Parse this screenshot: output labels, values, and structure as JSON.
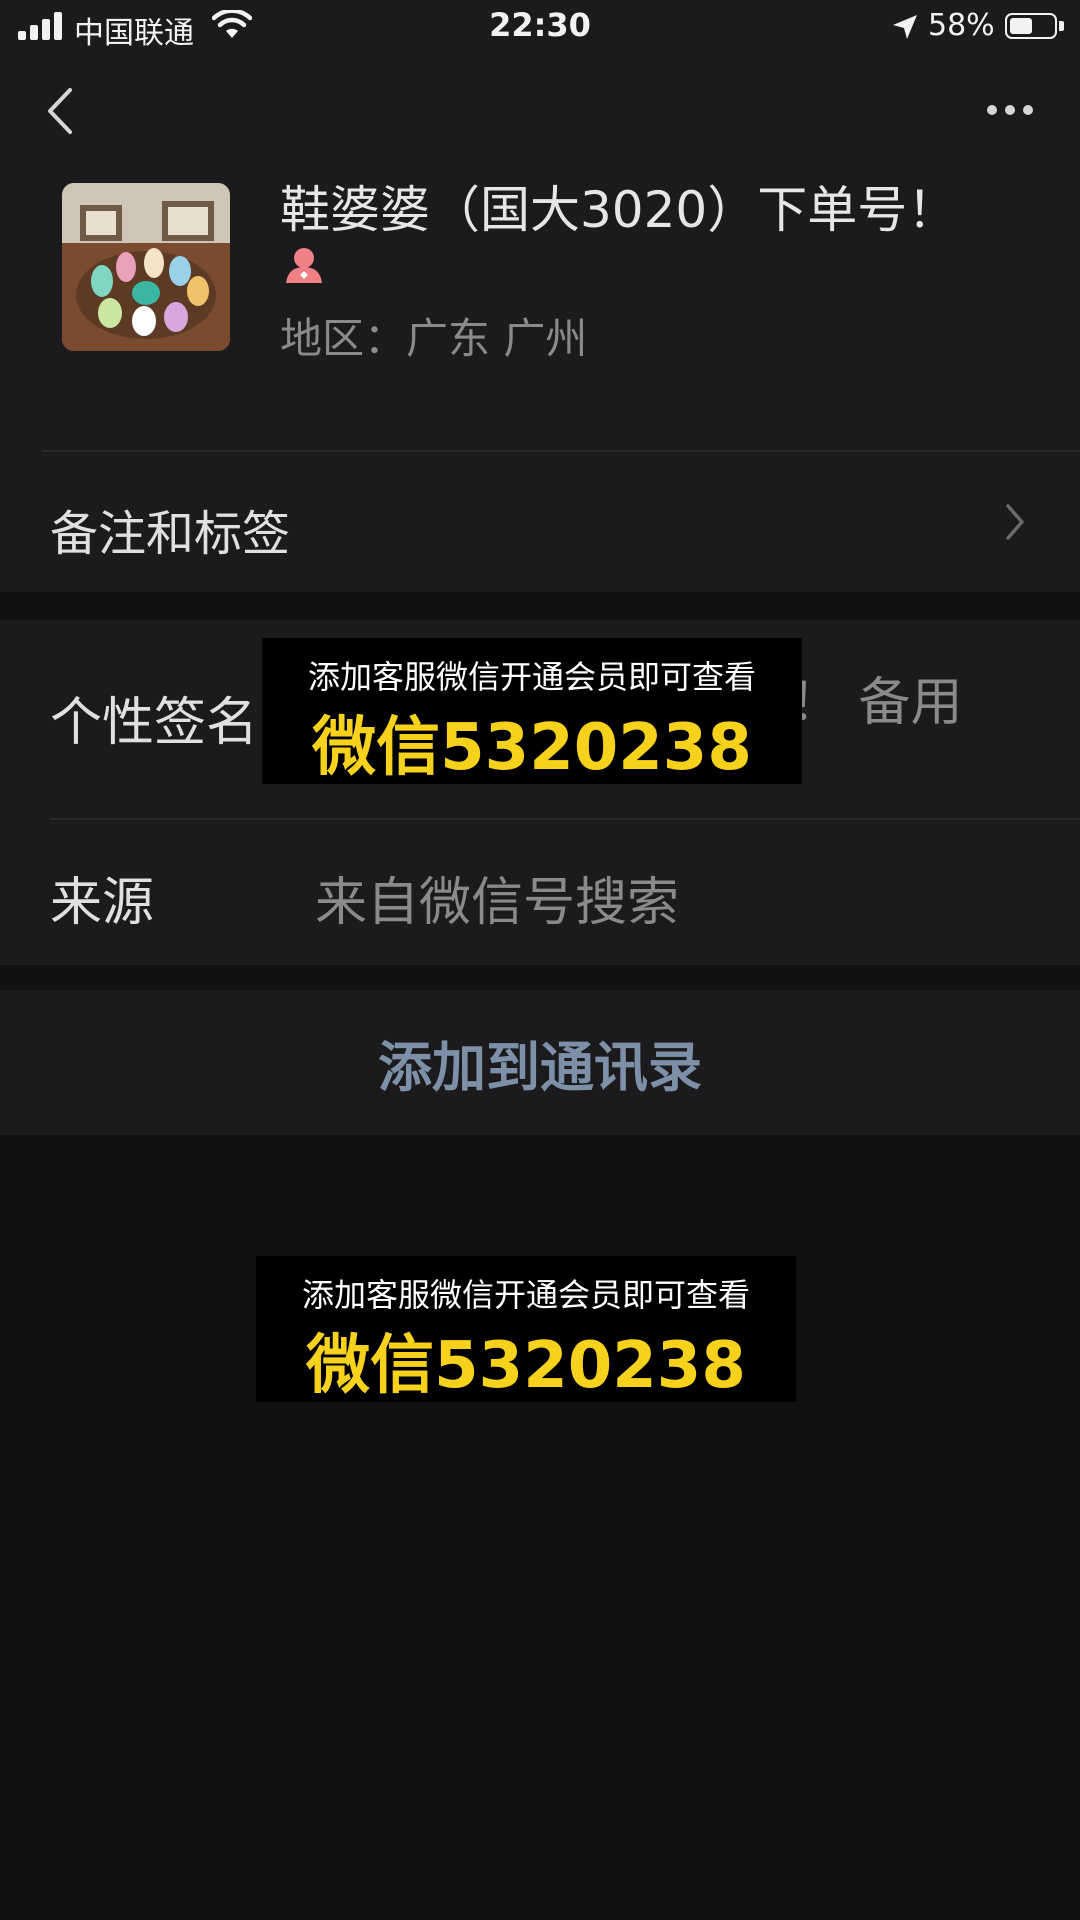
{
  "status_bar": {
    "carrier": "中国联通",
    "time": "22:30",
    "battery_percent": "58%",
    "battery_level": 0.58,
    "icons": [
      "signal-icon",
      "wifi-icon",
      "location-arrow-icon",
      "battery-icon"
    ]
  },
  "nav": {
    "back_icon": "chevron-left-icon",
    "more_icon": "more-dots-icon"
  },
  "profile": {
    "name": "鞋婆婆（国大3020）下单号！",
    "gender_icon": "female-icon",
    "region": "地区：广东 广州"
  },
  "rows": {
    "remarks_label": "备注和标签",
    "signature_label": "个性签名",
    "signature_value_visible": "！ 备用",
    "source_label": "来源",
    "source_value": "来自微信号搜索"
  },
  "actions": {
    "add_to_contacts": "添加到通讯录"
  },
  "promo": {
    "line1": "添加客服微信开通会员即可查看",
    "line2": "微信5320238"
  },
  "colors": {
    "background": "#111013",
    "card": "#1b1a1d",
    "action_text": "#7d90a8",
    "promo_yellow": "#f7d21d"
  }
}
